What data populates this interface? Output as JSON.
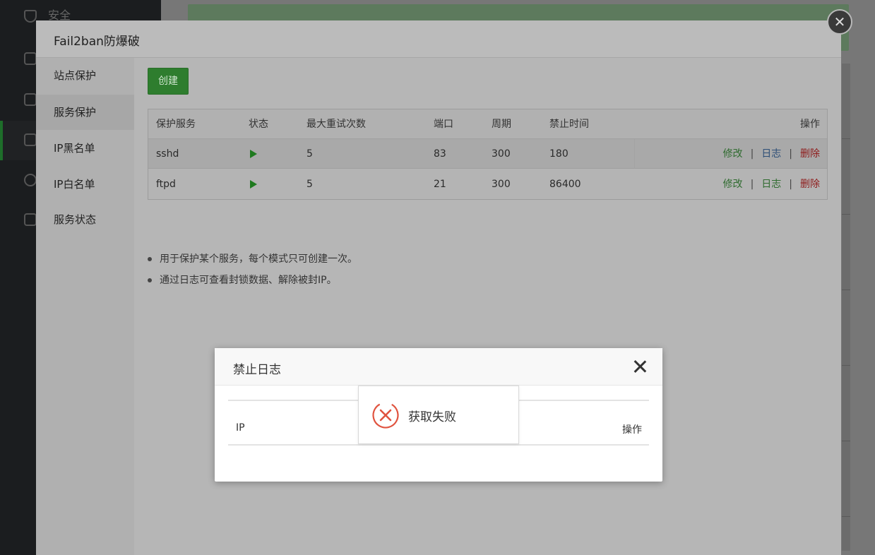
{
  "background": {
    "sidebar_items": [
      {
        "label": "安全",
        "icon": "shield-icon"
      },
      {
        "label": "",
        "icon": "folder-icon"
      },
      {
        "label": "",
        "icon": "calendar-icon"
      },
      {
        "label": "",
        "icon": "apps-icon"
      },
      {
        "label": "",
        "icon": "gear-icon"
      },
      {
        "label": "",
        "icon": "logout-icon"
      }
    ]
  },
  "layer": {
    "title": "Fail2ban防爆破",
    "close_icon": "close-circle-icon",
    "menu": [
      {
        "label": "站点保护"
      },
      {
        "label": "服务保护",
        "active": true
      },
      {
        "label": "IP黑名单"
      },
      {
        "label": "IP白名单"
      },
      {
        "label": "服务状态"
      }
    ],
    "create_label": "创建",
    "table": {
      "headers": [
        "保护服务",
        "状态",
        "最大重试次数",
        "端口",
        "周期",
        "禁止时间",
        "操作"
      ],
      "rows": [
        {
          "service": "sshd",
          "status": "play-icon",
          "max_retry": "5",
          "port": "83",
          "cycle": "300",
          "ban_time": "180",
          "edit": "修改",
          "log": "日志",
          "delete": "删除"
        },
        {
          "service": "ftpd",
          "status": "play-icon",
          "max_retry": "5",
          "port": "21",
          "cycle": "300",
          "ban_time": "86400",
          "edit": "修改",
          "log": "日志",
          "delete": "删除"
        }
      ],
      "separator": "|"
    },
    "notes": [
      "用于保护某个服务，每个模式只可创建一次。",
      "通过日志可查看封锁数据、解除被封IP。"
    ]
  },
  "dialog": {
    "title": "禁止日志",
    "columns": {
      "ip": "IP",
      "op": "操作"
    }
  },
  "toast": {
    "message": "获取失败",
    "icon": "error-circle-icon",
    "color": "#e0533f"
  }
}
